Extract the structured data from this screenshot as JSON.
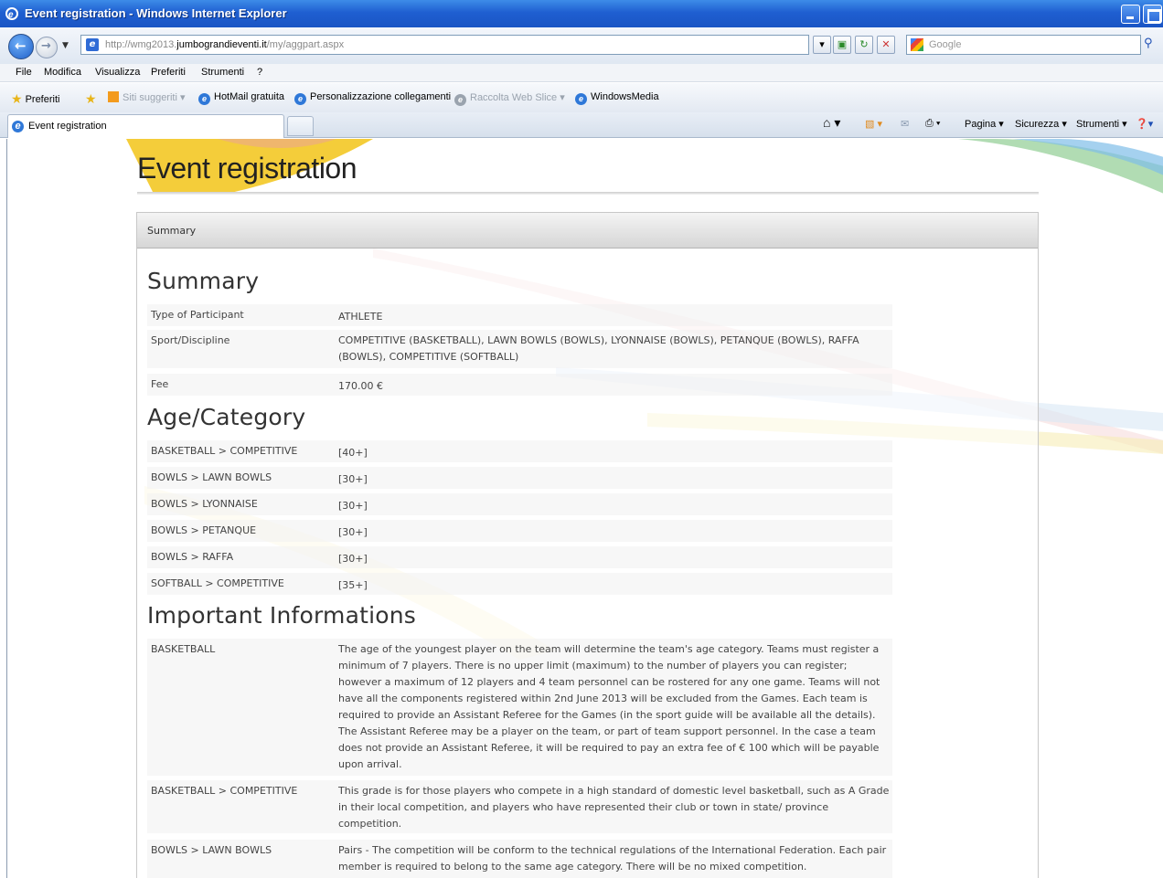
{
  "window": {
    "title": "Event registration - Windows Internet Explorer"
  },
  "addressbar": {
    "url_prefix": "http://wmg2013.",
    "url_domain": "jumbograndieventi.it",
    "url_path": "/my/aggpart.aspx",
    "search_placeholder": "Google"
  },
  "menu": [
    "File",
    "Modifica",
    "Visualizza",
    "Preferiti",
    "Strumenti",
    "?"
  ],
  "favorites": {
    "label": "Preferiti",
    "items": [
      "Siti suggeriti ▾",
      "HotMail gratuita",
      "Personalizzazione collegamenti",
      "Raccolta Web Slice ▾",
      "WindowsMedia"
    ]
  },
  "tab": {
    "label": "Event registration"
  },
  "commandbar": {
    "pagina": "Pagina ▾",
    "sicurezza": "Sicurezza ▾",
    "strumenti": "Strumenti ▾"
  },
  "page": {
    "title": "Event registration",
    "panel_header": "Summary",
    "summary": {
      "heading": "Summary",
      "rows": [
        {
          "key": "Type of Participant",
          "value": "ATHLETE"
        },
        {
          "key": "Sport/Discipline",
          "value": "COMPETITIVE (BASKETBALL), LAWN BOWLS (BOWLS), LYONNAISE (BOWLS), PETANQUE (BOWLS), RAFFA (BOWLS), COMPETITIVE (SOFTBALL)"
        },
        {
          "key": "Fee",
          "value": "170.00 €"
        }
      ]
    },
    "age_category": {
      "heading": "Age/Category",
      "rows": [
        {
          "key": "BASKETBALL > COMPETITIVE",
          "value": "[40+]"
        },
        {
          "key": "BOWLS > LAWN BOWLS",
          "value": "[30+]"
        },
        {
          "key": "BOWLS > LYONNAISE",
          "value": "[30+]"
        },
        {
          "key": "BOWLS > PETANQUE",
          "value": "[30+]"
        },
        {
          "key": "BOWLS > RAFFA",
          "value": "[30+]"
        },
        {
          "key": "SOFTBALL > COMPETITIVE",
          "value": "[35+]"
        }
      ]
    },
    "info": {
      "heading": "Important Informations",
      "rows": [
        {
          "key": "BASKETBALL",
          "value": "The age of the youngest player on the team will determine the team's age category. Teams must register a minimum of 7 players. There is no upper limit (maximum) to the number of players you can register; however a maximum of 12 players and 4 team personnel can be rostered for any one game. Teams will not have all the components registered within 2nd June 2013 will be excluded from the Games. Each team is required to provide an Assistant Referee for the Games (in the sport guide will be available all the details). The Assistant Referee may be a player on the team, or part of team support personnel. In the case a team does not provide an Assistant Referee, it will be required to pay an extra fee of € 100 which will be payable upon arrival."
        },
        {
          "key": "BASKETBALL > COMPETITIVE",
          "value": "This grade is for those players who compete in a high standard of domestic level basketball, such as A Grade in their local competition, and players who have represented their club or town in state/ province competition."
        },
        {
          "key": "BOWLS > LAWN BOWLS",
          "value": "Pairs - The competition will be conform to the technical regulations of the International Federation. Each pair member is required to belong to the same age category. There will be no mixed competition."
        }
      ]
    }
  }
}
